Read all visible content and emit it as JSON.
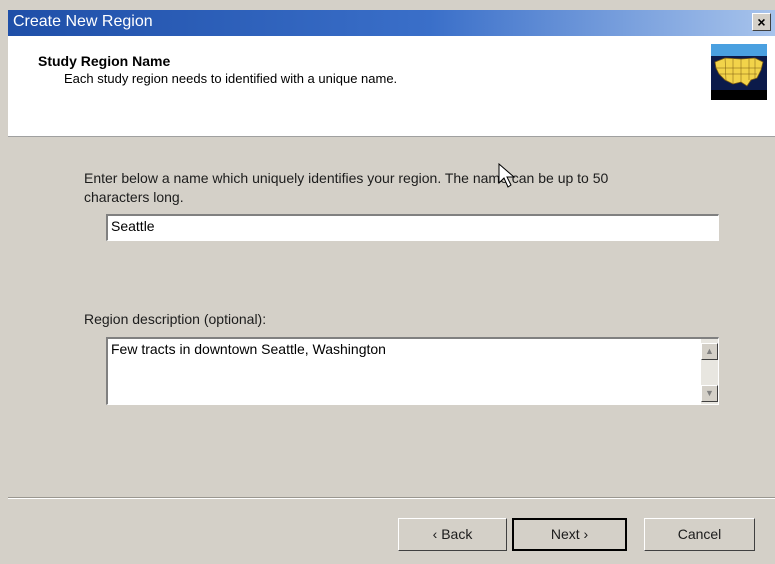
{
  "window": {
    "title": "Create New Region",
    "close_glyph": "×"
  },
  "header": {
    "title": "Study Region Name",
    "subtitle": "Each study region needs to identified with a unique name.",
    "icon": "usa-map-icon"
  },
  "form": {
    "name_prompt_line1": "Enter below a name which uniquely identifies your region. The name can be up to 50",
    "name_prompt_line2": "characters long.",
    "name_value": "Seattle",
    "description_label": "Region description (optional):",
    "description_value": "Few tracts in downtown Seattle, Washington"
  },
  "buttons": {
    "back_label": "‹ Back",
    "next_label": "Next ›",
    "cancel_label": "Cancel"
  },
  "colors": {
    "titlebar": "#1f4fa8",
    "dialog_bg": "#d4d0c8",
    "header_bg": "#ffffff"
  }
}
